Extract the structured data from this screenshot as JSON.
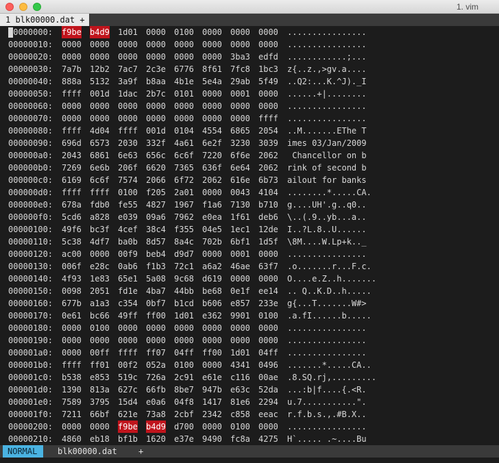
{
  "window": {
    "title": "1. vim"
  },
  "tabline": {
    "tab_label": "1 blk00000.dat +"
  },
  "colors": {
    "highlight": "#c0141c",
    "mode_bg": "#4ab3e2",
    "text": "#d8d8d8"
  },
  "hexdump": {
    "lines": [
      {
        "addr": "00000000:",
        "groups": [
          "f9be",
          "b4d9",
          "1d01",
          "0000",
          "0100",
          "0000",
          "0000",
          "0000"
        ],
        "ascii": "................",
        "hl": [
          0,
          1
        ]
      },
      {
        "addr": "00000010:",
        "groups": [
          "0000",
          "0000",
          "0000",
          "0000",
          "0000",
          "0000",
          "0000",
          "0000"
        ],
        "ascii": "................",
        "hl": []
      },
      {
        "addr": "00000020:",
        "groups": [
          "0000",
          "0000",
          "0000",
          "0000",
          "0000",
          "0000",
          "3ba3",
          "edfd"
        ],
        "ascii": "............;...",
        "hl": []
      },
      {
        "addr": "00000030:",
        "groups": [
          "7a7b",
          "12b2",
          "7ac7",
          "2c3e",
          "6776",
          "8f61",
          "7fc8",
          "1bc3"
        ],
        "ascii": "z{..z.,>gv.a....",
        "hl": []
      },
      {
        "addr": "00000040:",
        "groups": [
          "888a",
          "5132",
          "3a9f",
          "b8aa",
          "4b1e",
          "5e4a",
          "29ab",
          "5f49"
        ],
        "ascii": "..Q2:...K.^J)._I",
        "hl": []
      },
      {
        "addr": "00000050:",
        "groups": [
          "ffff",
          "001d",
          "1dac",
          "2b7c",
          "0101",
          "0000",
          "0001",
          "0000"
        ],
        "ascii": "......+|........",
        "hl": []
      },
      {
        "addr": "00000060:",
        "groups": [
          "0000",
          "0000",
          "0000",
          "0000",
          "0000",
          "0000",
          "0000",
          "0000"
        ],
        "ascii": "................",
        "hl": []
      },
      {
        "addr": "00000070:",
        "groups": [
          "0000",
          "0000",
          "0000",
          "0000",
          "0000",
          "0000",
          "0000",
          "ffff"
        ],
        "ascii": "................",
        "hl": []
      },
      {
        "addr": "00000080:",
        "groups": [
          "ffff",
          "4d04",
          "ffff",
          "001d",
          "0104",
          "4554",
          "6865",
          "2054"
        ],
        "ascii": "..M.......EThe T",
        "hl": []
      },
      {
        "addr": "00000090:",
        "groups": [
          "696d",
          "6573",
          "2030",
          "332f",
          "4a61",
          "6e2f",
          "3230",
          "3039"
        ],
        "ascii": "imes 03/Jan/2009",
        "hl": []
      },
      {
        "addr": "000000a0:",
        "groups": [
          "2043",
          "6861",
          "6e63",
          "656c",
          "6c6f",
          "7220",
          "6f6e",
          "2062"
        ],
        "ascii": " Chancellor on b",
        "hl": []
      },
      {
        "addr": "000000b0:",
        "groups": [
          "7269",
          "6e6b",
          "206f",
          "6620",
          "7365",
          "636f",
          "6e64",
          "2062"
        ],
        "ascii": "rink of second b",
        "hl": []
      },
      {
        "addr": "000000c0:",
        "groups": [
          "6169",
          "6c6f",
          "7574",
          "2066",
          "6f72",
          "2062",
          "616e",
          "6b73"
        ],
        "ascii": "ailout for banks",
        "hl": []
      },
      {
        "addr": "000000d0:",
        "groups": [
          "ffff",
          "ffff",
          "0100",
          "f205",
          "2a01",
          "0000",
          "0043",
          "4104"
        ],
        "ascii": "........*.....CA.",
        "hl": []
      },
      {
        "addr": "000000e0:",
        "groups": [
          "678a",
          "fdb0",
          "fe55",
          "4827",
          "1967",
          "f1a6",
          "7130",
          "b710"
        ],
        "ascii": "g....UH'.g..q0..",
        "hl": []
      },
      {
        "addr": "000000f0:",
        "groups": [
          "5cd6",
          "a828",
          "e039",
          "09a6",
          "7962",
          "e0ea",
          "1f61",
          "deb6"
        ],
        "ascii": "\\..(.9..yb...a..",
        "hl": []
      },
      {
        "addr": "00000100:",
        "groups": [
          "49f6",
          "bc3f",
          "4cef",
          "38c4",
          "f355",
          "04e5",
          "1ec1",
          "12de"
        ],
        "ascii": "I..?L.8..U......",
        "hl": []
      },
      {
        "addr": "00000110:",
        "groups": [
          "5c38",
          "4df7",
          "ba0b",
          "8d57",
          "8a4c",
          "702b",
          "6bf1",
          "1d5f"
        ],
        "ascii": "\\8M....W.Lp+k.._",
        "hl": []
      },
      {
        "addr": "00000120:",
        "groups": [
          "ac00",
          "0000",
          "00f9",
          "beb4",
          "d9d7",
          "0000",
          "0001",
          "0000"
        ],
        "ascii": "................",
        "hl": []
      },
      {
        "addr": "00000130:",
        "groups": [
          "006f",
          "e28c",
          "0ab6",
          "f1b3",
          "72c1",
          "a6a2",
          "46ae",
          "63f7"
        ],
        "ascii": ".o.......r...F.c.",
        "hl": []
      },
      {
        "addr": "00000140:",
        "groups": [
          "4f93",
          "1e83",
          "65e1",
          "5a08",
          "9c68",
          "d619",
          "0000",
          "0000"
        ],
        "ascii": "O....e.Z..h.......",
        "hl": []
      },
      {
        "addr": "00000150:",
        "groups": [
          "0098",
          "2051",
          "fd1e",
          "4ba7",
          "44bb",
          "be68",
          "0e1f",
          "ee14"
        ],
        "ascii": ".. Q..K.D..h.....",
        "hl": []
      },
      {
        "addr": "00000160:",
        "groups": [
          "677b",
          "a1a3",
          "c354",
          "0bf7",
          "b1cd",
          "b606",
          "e857",
          "233e"
        ],
        "ascii": "g{...T.......W#>",
        "hl": []
      },
      {
        "addr": "00000170:",
        "groups": [
          "0e61",
          "bc66",
          "49ff",
          "ff00",
          "1d01",
          "e362",
          "9901",
          "0100"
        ],
        "ascii": ".a.fI......b.....",
        "hl": []
      },
      {
        "addr": "00000180:",
        "groups": [
          "0000",
          "0100",
          "0000",
          "0000",
          "0000",
          "0000",
          "0000",
          "0000"
        ],
        "ascii": "................",
        "hl": []
      },
      {
        "addr": "00000190:",
        "groups": [
          "0000",
          "0000",
          "0000",
          "0000",
          "0000",
          "0000",
          "0000",
          "0000"
        ],
        "ascii": "................",
        "hl": []
      },
      {
        "addr": "000001a0:",
        "groups": [
          "0000",
          "00ff",
          "ffff",
          "ff07",
          "04ff",
          "ff00",
          "1d01",
          "04ff"
        ],
        "ascii": "................",
        "hl": []
      },
      {
        "addr": "000001b0:",
        "groups": [
          "ffff",
          "ff01",
          "00f2",
          "052a",
          "0100",
          "0000",
          "4341",
          "0496"
        ],
        "ascii": ".......*.....CA..",
        "hl": []
      },
      {
        "addr": "000001c0:",
        "groups": [
          "b538",
          "e853",
          "519c",
          "726a",
          "2c91",
          "e61e",
          "c116",
          "00ae"
        ],
        "ascii": ".8.SQ.rj,.........",
        "hl": []
      },
      {
        "addr": "000001d0:",
        "groups": [
          "1390",
          "813a",
          "627c",
          "66fb",
          "8be7",
          "947b",
          "e63c",
          "52da"
        ],
        "ascii": "...:b|f....{.<R.",
        "hl": []
      },
      {
        "addr": "000001e0:",
        "groups": [
          "7589",
          "3795",
          "15d4",
          "e0a6",
          "04f8",
          "1417",
          "81e6",
          "2294"
        ],
        "ascii": "u.7...........\".",
        "hl": []
      },
      {
        "addr": "000001f0:",
        "groups": [
          "7211",
          "66bf",
          "621e",
          "73a8",
          "2cbf",
          "2342",
          "c858",
          "eeac"
        ],
        "ascii": "r.f.b.s.,.#B.X..",
        "hl": []
      },
      {
        "addr": "00000200:",
        "groups": [
          "0000",
          "0000",
          "f9be",
          "b4d9",
          "d700",
          "0000",
          "0100",
          "0000"
        ],
        "ascii": "................",
        "hl": [
          2,
          3
        ]
      },
      {
        "addr": "00000210:",
        "groups": [
          "4860",
          "eb18",
          "bf1b",
          "1620",
          "e37e",
          "9490",
          "fc8a",
          "4275"
        ],
        "ascii": "H`..... .~....Bu",
        "hl": []
      }
    ]
  },
  "statusbar": {
    "mode": "NORMAL",
    "filename": "blk00000.dat",
    "modified": "+"
  }
}
